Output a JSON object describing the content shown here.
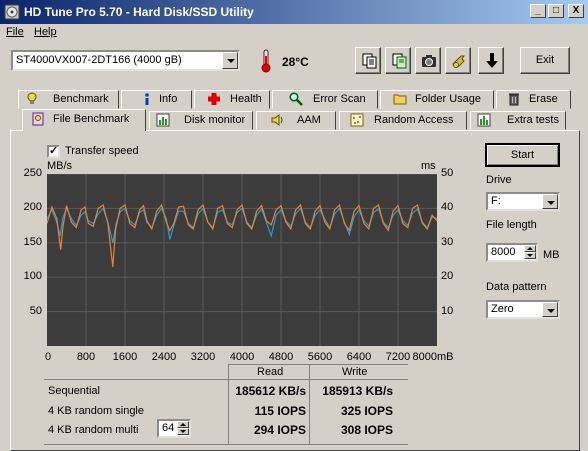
{
  "window": {
    "title": "HD Tune Pro 5.70 - Hard Disk/SSD Utility",
    "controls": {
      "minimize": "_",
      "maximize": "□",
      "close": "X"
    }
  },
  "menu": {
    "items": [
      "File",
      "Help"
    ]
  },
  "toolbar": {
    "drive": "ST4000VX007-2DT166 (4000 gB)",
    "temperature": "28°C",
    "exit_label": "Exit"
  },
  "tabs_top": [
    "Benchmark",
    "Info",
    "Health",
    "Error Scan",
    "Folder Usage",
    "Erase"
  ],
  "tabs_bottom": [
    "File Benchmark",
    "Disk monitor",
    "AAM",
    "Random Access",
    "Extra tests"
  ],
  "active_tab": "File Benchmark",
  "controls": {
    "transfer_speed_label": "Transfer speed",
    "transfer_speed_checked": true,
    "start_label": "Start",
    "drive_label": "Drive",
    "drive_value": "F:",
    "file_length_label": "File length",
    "file_length_value": "8000",
    "file_length_unit": "MB",
    "data_pattern_label": "Data pattern",
    "data_pattern_value": "Zero"
  },
  "chart_data": {
    "type": "line",
    "left_unit": "MB/s",
    "right_unit": "ms",
    "x_unit": "mB",
    "y_ticks_left": [
      "250",
      "200",
      "150",
      "100",
      "50"
    ],
    "y_ticks_right": [
      "50",
      "40",
      "30",
      "20",
      "10"
    ],
    "x_ticks": [
      "0",
      "800",
      "1600",
      "2400",
      "3200",
      "4000",
      "4800",
      "5600",
      "6400",
      "7200",
      "8000mB"
    ],
    "xlim": [
      0,
      8000
    ],
    "ylim_left": [
      0,
      250
    ],
    "ylim_right": [
      0,
      50
    ],
    "grid": true,
    "colors": {
      "read": "#1ea0d8",
      "write": "#f08030",
      "background": "#3c3c3c",
      "grid": "#5a5a5a"
    },
    "series": [
      {
        "key": "read",
        "x": [
          0,
          100,
          200,
          270,
          320,
          400,
          500,
          600,
          700,
          780,
          850,
          950,
          1050,
          1150,
          1250,
          1350,
          1420,
          1500,
          1600,
          1700,
          1800,
          1900,
          1980,
          2050,
          2150,
          2250,
          2350,
          2450,
          2520,
          2600,
          2700,
          2800,
          2900,
          3000,
          3100,
          3200,
          3300,
          3400,
          3500,
          3600,
          3700,
          3800,
          3900,
          4000,
          4100,
          4200,
          4300,
          4400,
          4500,
          4600,
          4700,
          4800,
          4900,
          5000,
          5100,
          5200,
          5300,
          5400,
          5500,
          5600,
          5700,
          5800,
          5900,
          6000,
          6100,
          6200,
          6300,
          6400,
          6500,
          6600,
          6700,
          6800,
          6900,
          7000,
          7100,
          7200,
          7300,
          7400,
          7500,
          7600,
          7700,
          7800,
          7900,
          8000
        ],
        "y": [
          185,
          198,
          180,
          160,
          185,
          200,
          185,
          175,
          190,
          195,
          182,
          178,
          192,
          200,
          180,
          150,
          178,
          195,
          200,
          182,
          176,
          194,
          198,
          180,
          172,
          190,
          200,
          184,
          155,
          175,
          196,
          196,
          178,
          172,
          192,
          200,
          180,
          172,
          194,
          198,
          180,
          176,
          194,
          200,
          180,
          172,
          190,
          199,
          180,
          160,
          190,
          198,
          182,
          174,
          192,
          200,
          180,
          172,
          190,
          198,
          184,
          172,
          192,
          200,
          180,
          162,
          188,
          198,
          182,
          174,
          194,
          199,
          180,
          172,
          190,
          198,
          182,
          175,
          193,
          199,
          180,
          172,
          188,
          185
        ]
      },
      {
        "key": "write",
        "x": [
          0,
          100,
          200,
          280,
          330,
          400,
          500,
          600,
          700,
          780,
          850,
          950,
          1050,
          1150,
          1250,
          1350,
          1410,
          1500,
          1600,
          1700,
          1800,
          1900,
          1980,
          2050,
          2150,
          2250,
          2350,
          2450,
          2520,
          2600,
          2700,
          2800,
          2900,
          3000,
          3100,
          3200,
          3300,
          3400,
          3500,
          3600,
          3700,
          3800,
          3900,
          4000,
          4100,
          4200,
          4300,
          4400,
          4500,
          4600,
          4700,
          4800,
          4900,
          5000,
          5100,
          5200,
          5300,
          5400,
          5500,
          5600,
          5700,
          5800,
          5900,
          6000,
          6100,
          6200,
          6300,
          6400,
          6500,
          6600,
          6700,
          6800,
          6900,
          7000,
          7100,
          7200,
          7300,
          7400,
          7500,
          7600,
          7700,
          7800,
          7900,
          8000
        ],
        "y": [
          178,
          202,
          185,
          140,
          175,
          204,
          180,
          172,
          198,
          202,
          178,
          174,
          200,
          205,
          178,
          115,
          170,
          200,
          205,
          178,
          172,
          198,
          204,
          182,
          170,
          196,
          205,
          180,
          168,
          178,
          202,
          203,
          176,
          170,
          198,
          205,
          180,
          170,
          200,
          204,
          178,
          172,
          198,
          205,
          178,
          170,
          196,
          204,
          182,
          176,
          198,
          204,
          180,
          170,
          198,
          205,
          178,
          170,
          196,
          204,
          180,
          170,
          198,
          205,
          178,
          168,
          196,
          204,
          178,
          170,
          200,
          205,
          178,
          168,
          196,
          204,
          178,
          172,
          200,
          205,
          178,
          170,
          190,
          182
        ]
      }
    ]
  },
  "results": {
    "col_read": "Read",
    "col_write": "Write",
    "rows": [
      {
        "label": "Sequential",
        "read": "185612 KB/s",
        "write": "185913 KB/s"
      },
      {
        "label": "4 KB random single",
        "read": "115 IOPS",
        "write": "325 IOPS"
      },
      {
        "label": "4 KB random multi",
        "read": "294 IOPS",
        "write": "308 IOPS"
      }
    ],
    "queue_depth": "64"
  }
}
